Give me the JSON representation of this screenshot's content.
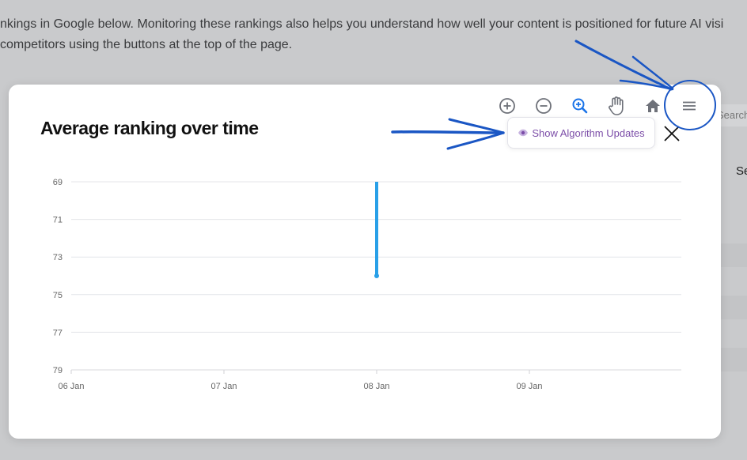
{
  "background": {
    "intro_line1": "nkings in Google below. Monitoring these rankings also helps you understand how well your content is positioned for future AI visi",
    "intro_line2": "competitors using the buttons at the top of the page.",
    "search_partial": "Search",
    "side_partial": "Se"
  },
  "modal": {
    "title": "Average ranking over time",
    "algo_button_label": "Show Algorithm Updates"
  },
  "toolbar": {
    "icons": [
      "zoom-in-icon",
      "zoom-out-icon",
      "zoom-selection-icon",
      "pan-hand-icon",
      "reset-home-icon",
      "menu-icon"
    ],
    "active_color": "#1a73e8",
    "icon_color": "#6e7179"
  },
  "colors": {
    "series": "#29a0e8",
    "algo_text": "#7c4ea8",
    "annotation": "#1a56c4"
  },
  "chart_data": {
    "type": "line",
    "title": "Average ranking over time",
    "x_categories": [
      "06 Jan",
      "07 Jan",
      "08 Jan",
      "09 Jan"
    ],
    "y_ticks": [
      69,
      71,
      73,
      75,
      77,
      79
    ],
    "ylim": [
      69,
      79
    ],
    "y_reversed": true,
    "grid": true,
    "series": [
      {
        "points": [
          {
            "x": "08 Jan",
            "y": 69
          },
          {
            "x": "08 Jan",
            "y": 74
          }
        ]
      }
    ]
  }
}
